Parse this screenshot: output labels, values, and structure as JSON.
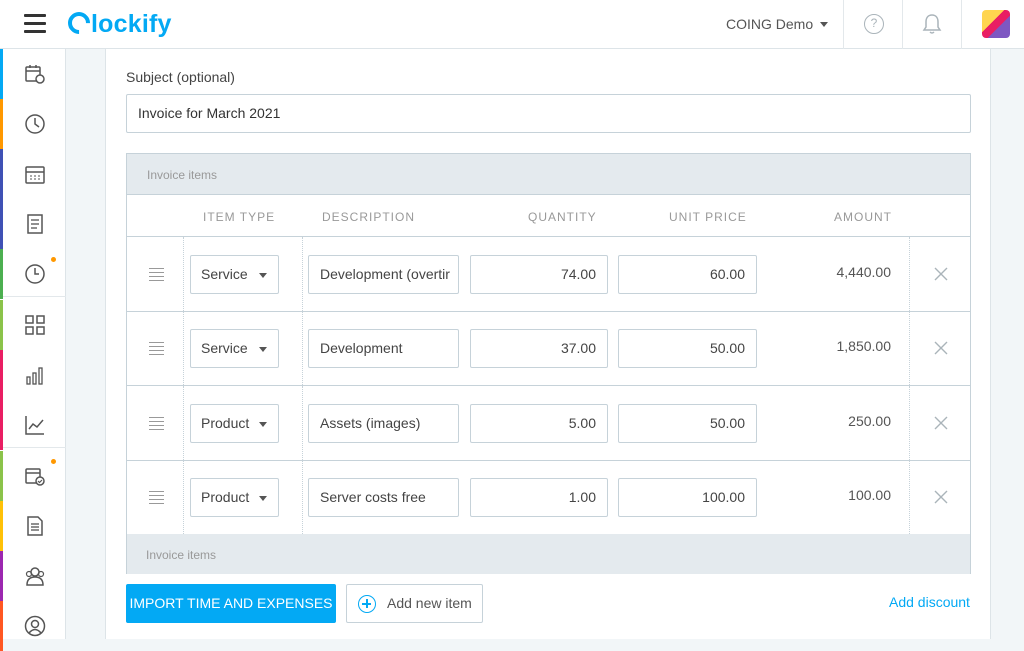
{
  "header": {
    "app_name": "Clockify",
    "logo_rest": "lockify",
    "workspace": "COING Demo",
    "help_glyph": "?",
    "icons": [
      "hamburger-menu-icon",
      "help-icon",
      "bell-icon",
      "avatar"
    ]
  },
  "sidebar": {
    "items": [
      {
        "name": "timesheet",
        "icon": "calendar-clock-icon",
        "color": "#03a9f4"
      },
      {
        "name": "time-tracker",
        "icon": "clock-icon",
        "color": "#ff9800"
      },
      {
        "name": "calendar",
        "icon": "calendar-icon",
        "color": "#3f51b5"
      },
      {
        "name": "approvals",
        "icon": "document-list-icon",
        "color": "#3f51b5"
      },
      {
        "name": "time-off",
        "icon": "clock-alert-icon",
        "color": "#4caf50",
        "notification": true
      },
      {
        "name": "dashboard",
        "icon": "grid-icon",
        "color": "#8bc34a"
      },
      {
        "name": "reports",
        "icon": "bar-chart-icon",
        "color": "#e91e63"
      },
      {
        "name": "analytics",
        "icon": "line-chart-icon",
        "color": "#e91e63"
      },
      {
        "name": "schedule",
        "icon": "calendar-check-icon",
        "color": "#8bc34a",
        "notification": true
      },
      {
        "name": "invoices",
        "icon": "invoice-icon",
        "color": "#ffc107"
      },
      {
        "name": "team",
        "icon": "team-icon",
        "color": "#9c27b0"
      },
      {
        "name": "clients",
        "icon": "user-circle-icon",
        "color": "#ff5722"
      }
    ]
  },
  "form": {
    "subject_label": "Subject (optional)",
    "subject_value": "Invoice for March 2021"
  },
  "items": {
    "header_label": "Invoice items",
    "footer_label": "Invoice items",
    "columns": [
      "ITEM TYPE",
      "DESCRIPTION",
      "QUANTITY",
      "UNIT PRICE",
      "AMOUNT"
    ],
    "rows": [
      {
        "type": "Service",
        "description": "Development (overtir",
        "quantity": "74.00",
        "unit_price": "60.00",
        "amount": "4,440.00"
      },
      {
        "type": "Service",
        "description": "Development",
        "quantity": "37.00",
        "unit_price": "50.00",
        "amount": "1,850.00"
      },
      {
        "type": "Product",
        "description": "Assets (images)",
        "quantity": "5.00",
        "unit_price": "50.00",
        "amount": "250.00"
      },
      {
        "type": "Product",
        "description": "Server costs free",
        "quantity": "1.00",
        "unit_price": "100.00",
        "amount": "100.00"
      }
    ]
  },
  "actions": {
    "import_label": "IMPORT TIME AND EXPENSES",
    "add_item_label": "Add new item",
    "add_discount_label": "Add discount"
  },
  "colors": {
    "accent": "#03a9f4",
    "table_header_bg": "#e4eaee",
    "border": "#c6d2d9"
  }
}
